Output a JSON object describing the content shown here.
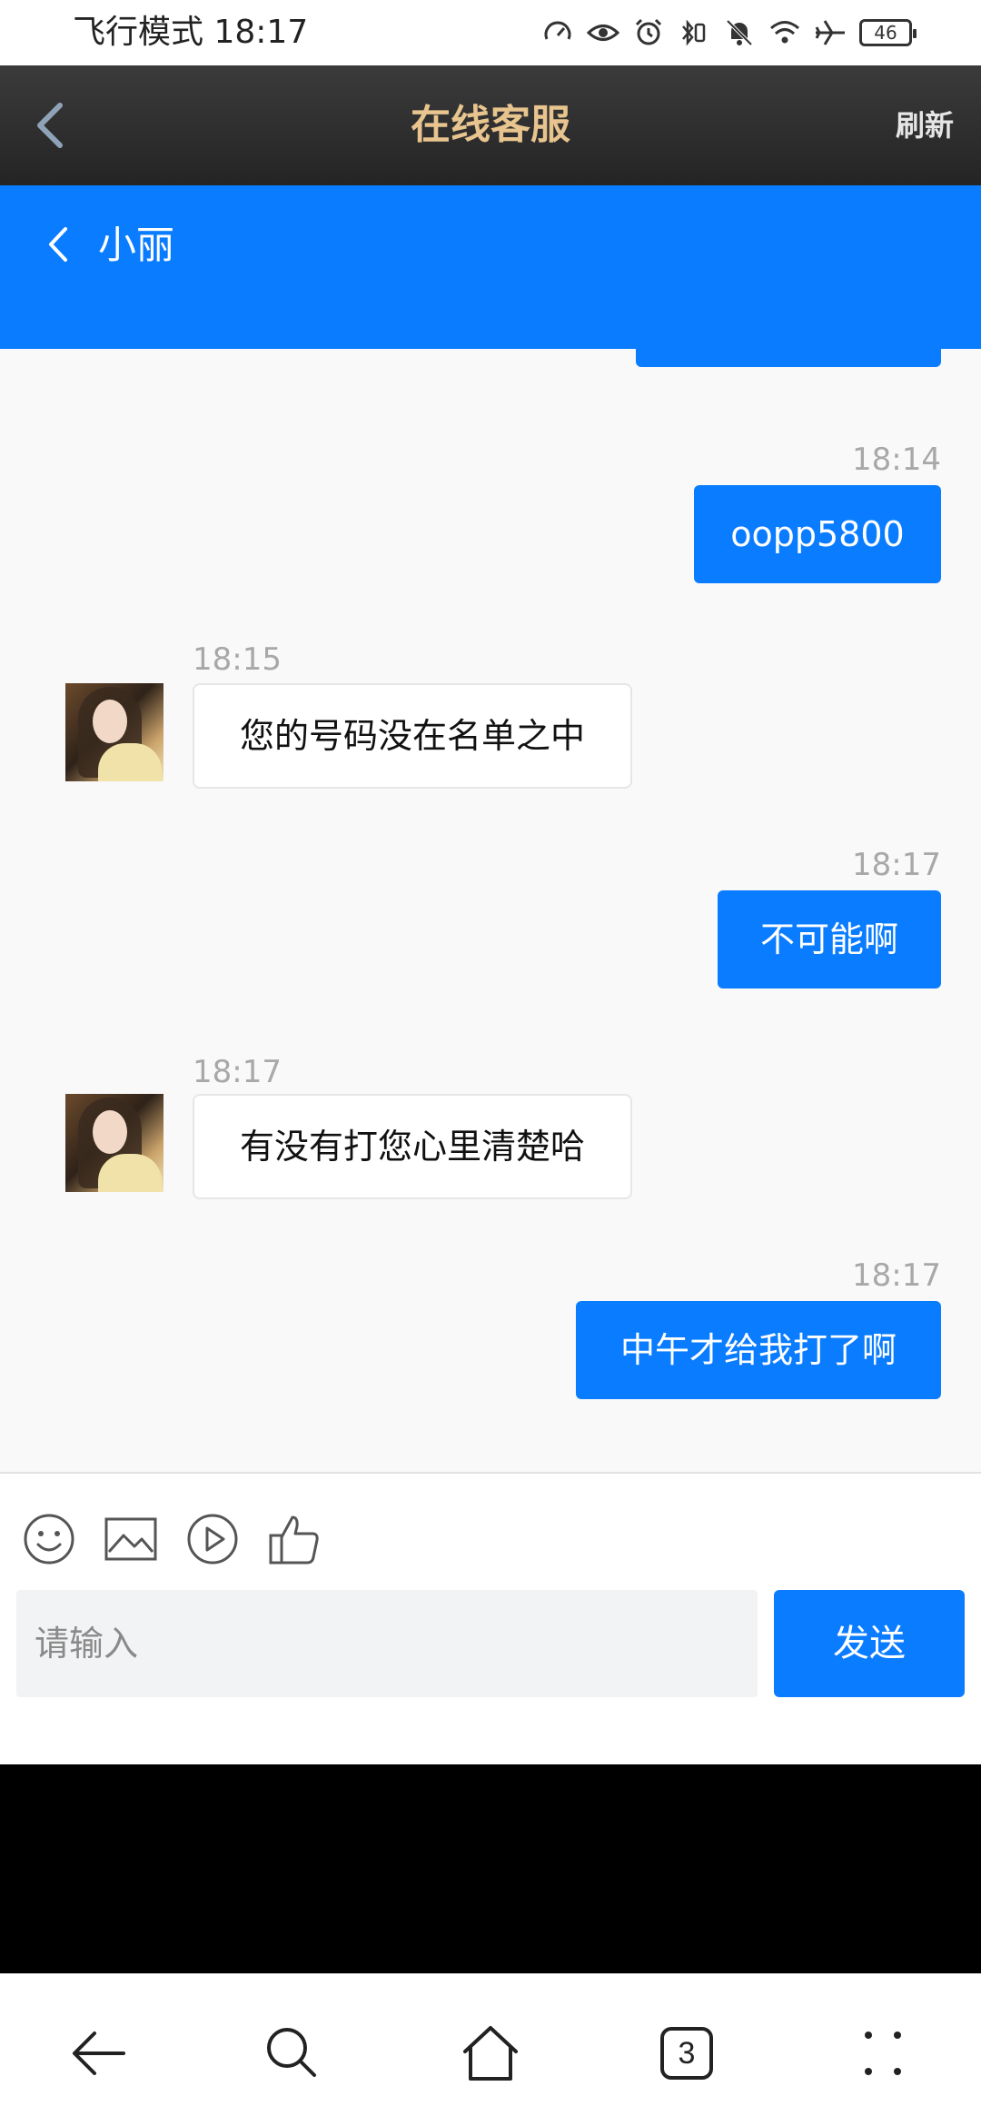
{
  "status_bar": {
    "mode_time": "飞行模式 18:17",
    "battery": "46"
  },
  "app_bar": {
    "title": "在线客服",
    "refresh_label": "刷新"
  },
  "chat_header": {
    "contact_name": "小丽"
  },
  "messages": [
    {
      "direction": "out",
      "time": "18:14",
      "text": "oopp5800"
    },
    {
      "direction": "in",
      "time": "18:15",
      "text": "您的号码没在名单之中"
    },
    {
      "direction": "out",
      "time": "18:17",
      "text": "不可能啊"
    },
    {
      "direction": "in",
      "time": "18:17",
      "text": "有没有打您心里清楚哈"
    },
    {
      "direction": "out",
      "time": "18:17",
      "text": "中午才给我打了啊"
    }
  ],
  "input": {
    "placeholder": "请输入",
    "send_label": "发送"
  },
  "browser_nav": {
    "tab_count": "3"
  },
  "colors": {
    "accent": "#0a7cff",
    "title_gold": "#e8c48e",
    "header_dark": "#2e2e2e"
  }
}
